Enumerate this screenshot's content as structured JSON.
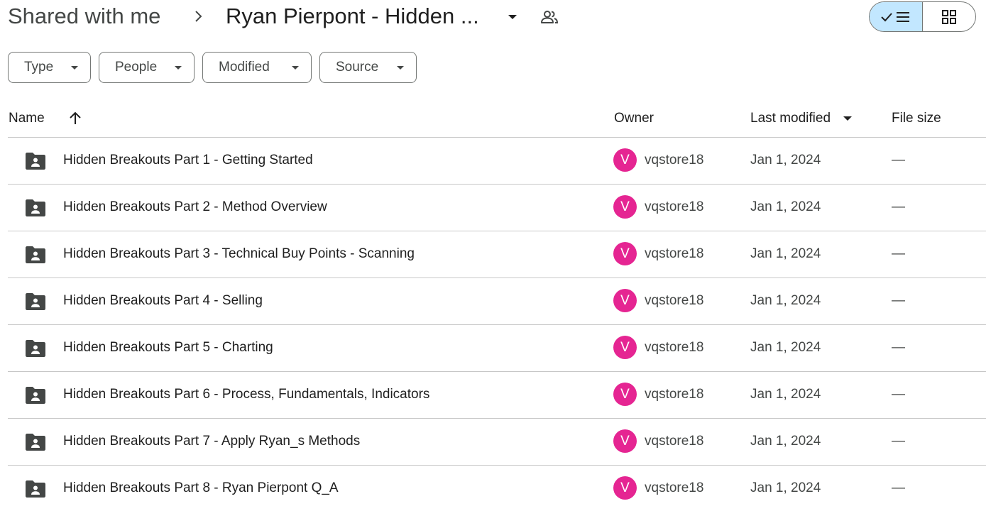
{
  "breadcrumb": {
    "root": "Shared with me",
    "separator_icon": "chevron-right-icon",
    "current": "Ryan Pierpont - Hidden ...",
    "caret_icon": "arrow-drop-down-icon",
    "shared_icon": "people-icon"
  },
  "view_toggle": {
    "list_icon": "check-list-icon",
    "grid_icon": "grid-icon",
    "selected": "list",
    "selected_color": "#c2e7ff"
  },
  "filters": [
    {
      "label": "Type"
    },
    {
      "label": "People"
    },
    {
      "label": "Modified"
    },
    {
      "label": "Source"
    }
  ],
  "columns": {
    "name": "Name",
    "owner": "Owner",
    "last_modified": "Last modified",
    "file_size": "File size"
  },
  "rows": [
    {
      "name": "Hidden Breakouts Part 1 - Getting Started",
      "owner_initial": "V",
      "owner": "vqstore18",
      "modified": "Jan 1, 2024",
      "size": "—"
    },
    {
      "name": "Hidden Breakouts Part 2 - Method Overview",
      "owner_initial": "V",
      "owner": "vqstore18",
      "modified": "Jan 1, 2024",
      "size": "—"
    },
    {
      "name": "Hidden Breakouts Part 3 - Technical Buy Points - Scanning",
      "owner_initial": "V",
      "owner": "vqstore18",
      "modified": "Jan 1, 2024",
      "size": "—"
    },
    {
      "name": "Hidden Breakouts Part 4 - Selling",
      "owner_initial": "V",
      "owner": "vqstore18",
      "modified": "Jan 1, 2024",
      "size": "—"
    },
    {
      "name": "Hidden Breakouts Part 5 - Charting",
      "owner_initial": "V",
      "owner": "vqstore18",
      "modified": "Jan 1, 2024",
      "size": "—"
    },
    {
      "name": "Hidden Breakouts Part 6 - Process, Fundamentals, Indicators",
      "owner_initial": "V",
      "owner": "vqstore18",
      "modified": "Jan 1, 2024",
      "size": "—"
    },
    {
      "name": "Hidden Breakouts Part 7 - Apply Ryan_s Methods",
      "owner_initial": "V",
      "owner": "vqstore18",
      "modified": "Jan 1, 2024",
      "size": "—"
    },
    {
      "name": "Hidden Breakouts Part 8 - Ryan Pierpont Q_A",
      "owner_initial": "V",
      "owner": "vqstore18",
      "modified": "Jan 1, 2024",
      "size": "—"
    }
  ],
  "colors": {
    "avatar": "#e52592",
    "folder_icon": "#444746"
  }
}
